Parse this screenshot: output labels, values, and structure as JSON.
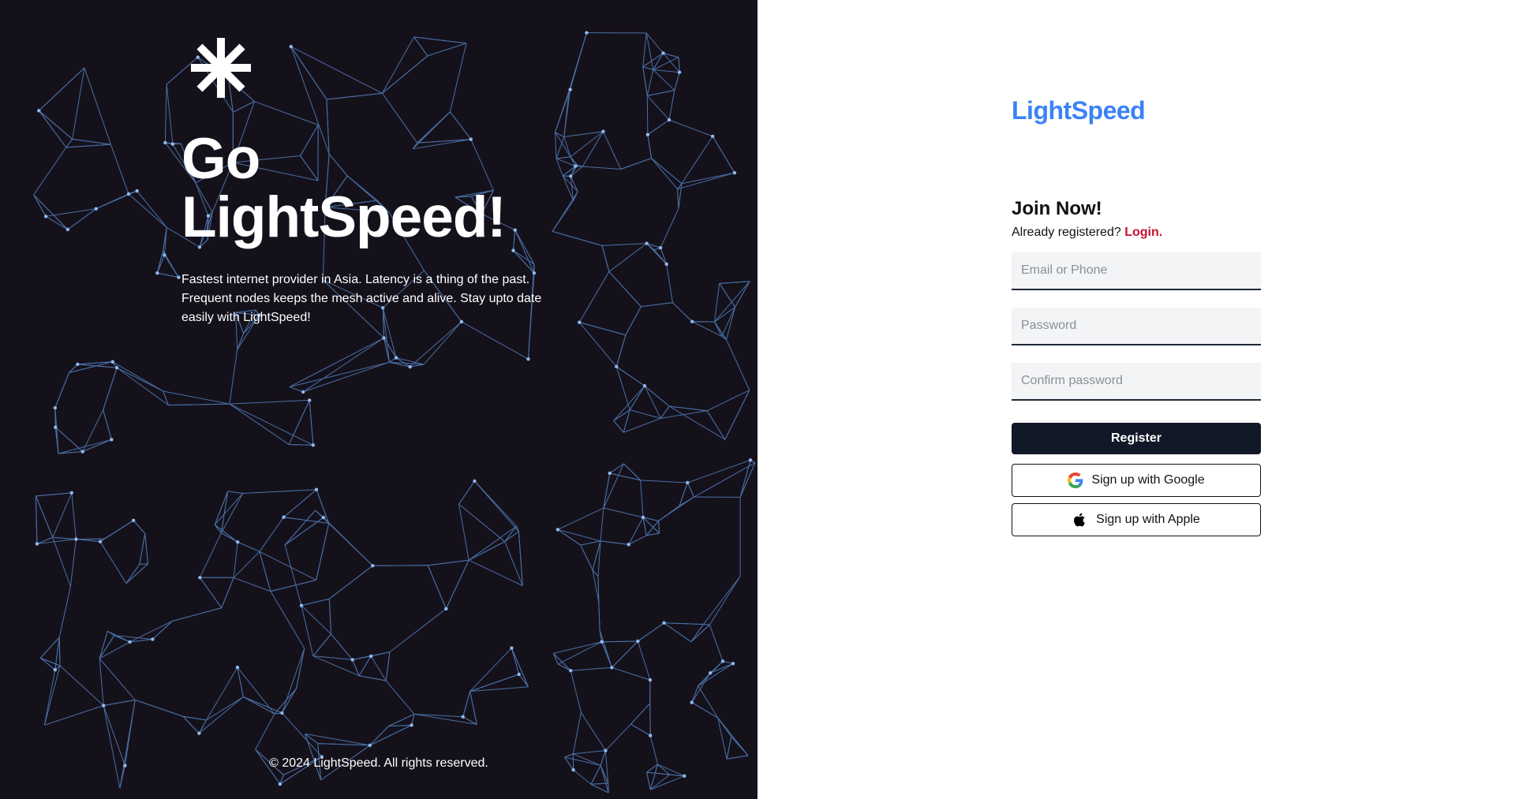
{
  "hero": {
    "title_line1": "Go",
    "title_line2": "LightSpeed!",
    "description": "Fastest internet provider in Asia. Latency is a thing of the past. Frequent nodes keeps the mesh active and alive. Stay upto date easily with LightSpeed!",
    "copyright": "© 2024 LightSpeed. All rights reserved."
  },
  "brand": {
    "logo_text": "LightSpeed",
    "accent_color": "#3b82f6",
    "dark_bg": "#15111b"
  },
  "form": {
    "title": "Join Now!",
    "already_text": "Already registered?",
    "login_label": "Login.",
    "email_placeholder": "Email or Phone",
    "password_placeholder": "Password",
    "confirm_placeholder": "Confirm password",
    "register_label": "Register",
    "google_label": "Sign up with Google",
    "apple_label": "Sign up with Apple"
  }
}
